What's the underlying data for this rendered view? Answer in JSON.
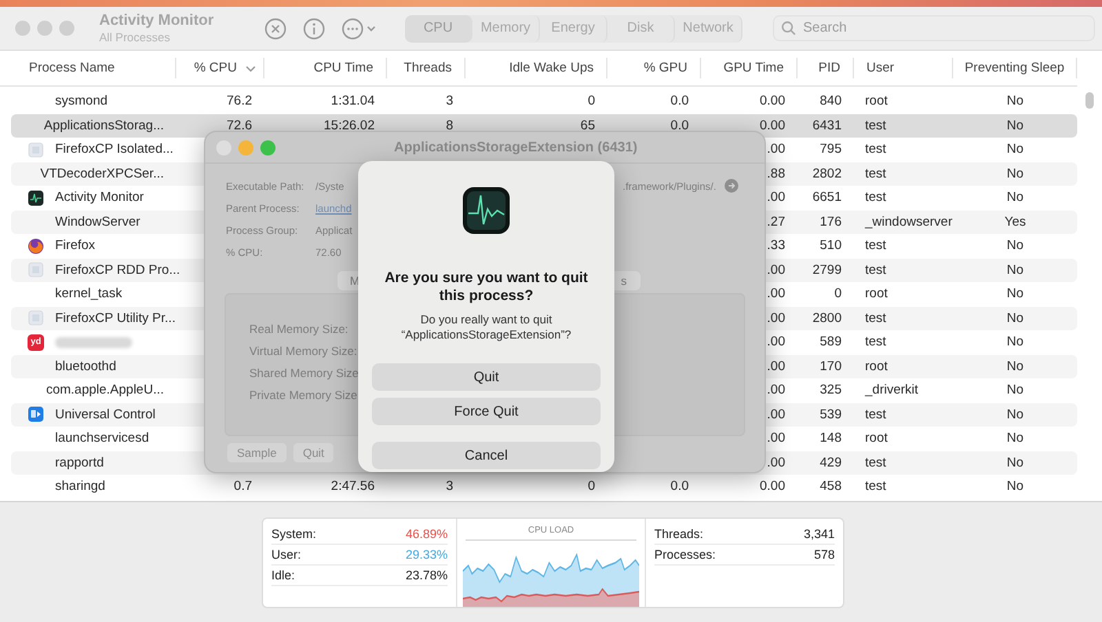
{
  "window": {
    "title": "Activity Monitor",
    "subtitle": "All Processes"
  },
  "tabs": [
    {
      "label": "CPU",
      "selected": true
    },
    {
      "label": "Memory",
      "selected": false
    },
    {
      "label": "Energy",
      "selected": false
    },
    {
      "label": "Disk",
      "selected": false
    },
    {
      "label": "Network",
      "selected": false
    }
  ],
  "search": {
    "placeholder": "Search"
  },
  "table": {
    "columns": [
      {
        "label": "Process Name",
        "sorted": false
      },
      {
        "label": "% CPU",
        "sorted": true
      },
      {
        "label": "CPU Time",
        "sorted": false
      },
      {
        "label": "Threads",
        "sorted": false
      },
      {
        "label": "Idle Wake Ups",
        "sorted": false
      },
      {
        "label": "% GPU",
        "sorted": false
      },
      {
        "label": "GPU Time",
        "sorted": false
      },
      {
        "label": "PID",
        "sorted": false
      },
      {
        "label": "User",
        "sorted": false
      },
      {
        "label": "Preventing Sleep",
        "sorted": false
      }
    ],
    "rows": [
      {
        "kind": "plain",
        "name": "sysmond",
        "cpu": "76.2",
        "cpu_time": "1:31.04",
        "threads": "3",
        "idle_wake_ups": "0",
        "gpu": "0.0",
        "gpu_time": "0.00",
        "pid": "840",
        "user": "root",
        "preventing_sleep": "No",
        "selected": false,
        "redacted": false
      },
      {
        "kind": "plain",
        "name": "ApplicationsStorag...",
        "cpu": "72.6",
        "cpu_time": "15:26.02",
        "threads": "8",
        "idle_wake_ups": "65",
        "gpu": "0.0",
        "gpu_time": "0.00",
        "pid": "6431",
        "user": "test",
        "preventing_sleep": "No",
        "selected": true,
        "redacted": false
      },
      {
        "kind": "firefoxcp",
        "name": "FirefoxCP Isolated...",
        "gpu_time": ".00",
        "pid": "795",
        "user": "test",
        "preventing_sleep": "No",
        "selected": false,
        "redacted": false
      },
      {
        "kind": "plain",
        "name": "VTDecoderXPCSer...",
        "gpu_time": ".88",
        "pid": "2802",
        "user": "test",
        "preventing_sleep": "No",
        "selected": false,
        "redacted": false
      },
      {
        "kind": "activity",
        "name": "Activity Monitor",
        "gpu_time": ".00",
        "pid": "6651",
        "user": "test",
        "preventing_sleep": "No",
        "selected": false,
        "redacted": false
      },
      {
        "kind": "plain",
        "name": "WindowServer",
        "gpu_time": ".27",
        "pid": "176",
        "user": "_windowserver",
        "preventing_sleep": "Yes",
        "selected": false,
        "redacted": false
      },
      {
        "kind": "firefox",
        "name": "Firefox",
        "gpu_time": ".33",
        "pid": "510",
        "user": "test",
        "preventing_sleep": "No",
        "selected": false,
        "redacted": false
      },
      {
        "kind": "firefoxcp",
        "name": "FirefoxCP RDD Pro...",
        "gpu_time": ".00",
        "pid": "2799",
        "user": "test",
        "preventing_sleep": "No",
        "selected": false,
        "redacted": false
      },
      {
        "kind": "plain",
        "name": "kernel_task",
        "gpu_time": ".00",
        "pid": "0",
        "user": "root",
        "preventing_sleep": "No",
        "selected": false,
        "redacted": false
      },
      {
        "kind": "firefoxcp",
        "name": "FirefoxCP Utility Pr...",
        "gpu_time": ".00",
        "pid": "2800",
        "user": "test",
        "preventing_sleep": "No",
        "selected": false,
        "redacted": false
      },
      {
        "kind": "yd",
        "icon_label": "yd",
        "gpu_time": ".00",
        "pid": "589",
        "user": "test",
        "preventing_sleep": "No",
        "selected": false,
        "redacted": true
      },
      {
        "kind": "plain",
        "name": "bluetoothd",
        "gpu_time": ".00",
        "pid": "170",
        "user": "root",
        "preventing_sleep": "No",
        "selected": false,
        "redacted": false
      },
      {
        "kind": "plain",
        "name": "com.apple.AppleU...",
        "gpu_time": ".00",
        "pid": "325",
        "user": "_driverkit",
        "preventing_sleep": "No",
        "selected": false,
        "redacted": false
      },
      {
        "kind": "universal",
        "name": "Universal Control",
        "gpu_time": ".00",
        "pid": "539",
        "user": "test",
        "preventing_sleep": "No",
        "selected": false,
        "redacted": false
      },
      {
        "kind": "plain",
        "name": "launchservicesd",
        "gpu_time": ".00",
        "pid": "148",
        "user": "root",
        "preventing_sleep": "No",
        "selected": false,
        "redacted": false
      },
      {
        "kind": "plain",
        "name": "rapportd",
        "gpu_time": ".00",
        "pid": "429",
        "user": "test",
        "preventing_sleep": "No",
        "selected": false,
        "redacted": false
      },
      {
        "kind": "plain",
        "name": "sharingd",
        "cpu": "0.7",
        "cpu_time": "2:47.56",
        "threads": "3",
        "idle_wake_ups": "0",
        "gpu": "0.0",
        "gpu_time": "0.00",
        "pid": "458",
        "user": "test",
        "preventing_sleep": "No",
        "selected": false,
        "redacted": false
      }
    ]
  },
  "info_window": {
    "title": "ApplicationsStorageExtension (6431)",
    "fields": [
      {
        "label": "Executable Path:",
        "value": "/Syste",
        "tail": ".framework/Plugins/."
      },
      {
        "label": "Parent Process:",
        "value": "launchd",
        "link": true
      },
      {
        "label": "Process Group:",
        "value": "Applicat",
        "link": false
      },
      {
        "label": "% CPU:",
        "value": "72.60",
        "link": false
      }
    ],
    "tabs": [
      "M",
      "s"
    ],
    "memory_labels": [
      "Real Memory Size:",
      "Virtual Memory Size:",
      "Shared Memory Size",
      "Private Memory Size"
    ],
    "buttons": [
      "Sample",
      "Quit"
    ]
  },
  "alert": {
    "title": "Are you sure you want to quit this process?",
    "message": "Do you really want to quit “ApplicationsStorageExtension”?",
    "buttons": [
      "Quit",
      "Force Quit",
      "Cancel"
    ]
  },
  "cpu_stats": [
    {
      "label": "System:",
      "value": "46.89%",
      "color": "#e8504a"
    },
    {
      "label": "User:",
      "value": "29.33%",
      "color": "#45a9de"
    },
    {
      "label": "Idle:",
      "value": "23.78%",
      "color": "#222222"
    }
  ],
  "cpu_load": {
    "title": "CPU LOAD"
  },
  "counts": [
    {
      "label": "Threads:",
      "value": "3,341"
    },
    {
      "label": "Processes:",
      "value": "578"
    }
  ]
}
